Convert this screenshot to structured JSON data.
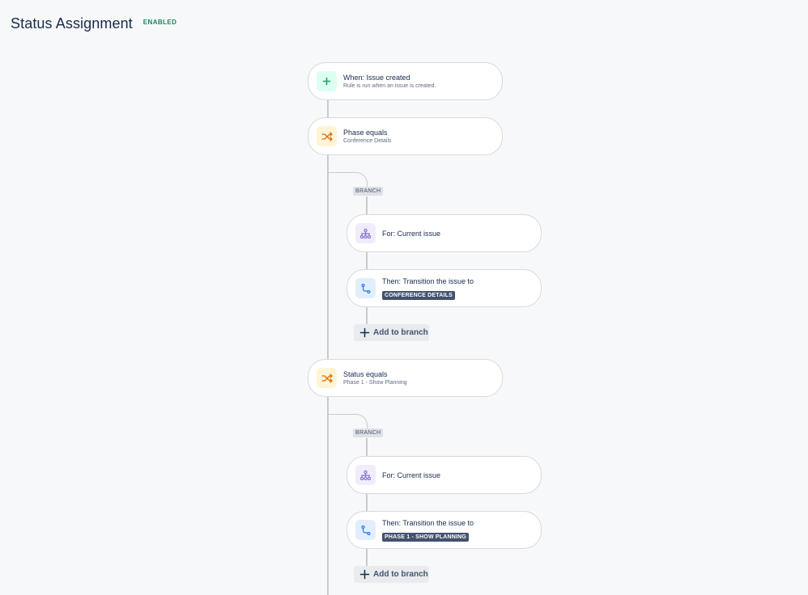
{
  "header": {
    "title": "Status Assignment",
    "status": "ENABLED"
  },
  "trigger": {
    "title": "When: Issue created",
    "subtitle": "Rule is run when an issue is created.",
    "icon": "plus-icon"
  },
  "conditions": [
    {
      "title": "Phase equals",
      "subtitle": "Conference Details",
      "icon": "shuffle-icon",
      "branch": {
        "tag": "BRANCH",
        "for_label": "For: Current issue",
        "then_label": "Then: Transition the issue to",
        "target_status": "CONFERENCE DETAILS",
        "add_label": "Add to branch"
      }
    },
    {
      "title": "Status equals",
      "subtitle": "Phase 1 - Show Planning",
      "icon": "shuffle-icon",
      "branch": {
        "tag": "BRANCH",
        "for_label": "For: Current issue",
        "then_label": "Then: Transition the issue to",
        "target_status": "PHASE 1 - SHOW PLANNING",
        "add_label": "Add to branch"
      }
    }
  ],
  "colors": {
    "background": "#f7f8f9",
    "enabled": "#1f845a",
    "lozenge": "#42526e",
    "connector": "#c7cbd1"
  }
}
